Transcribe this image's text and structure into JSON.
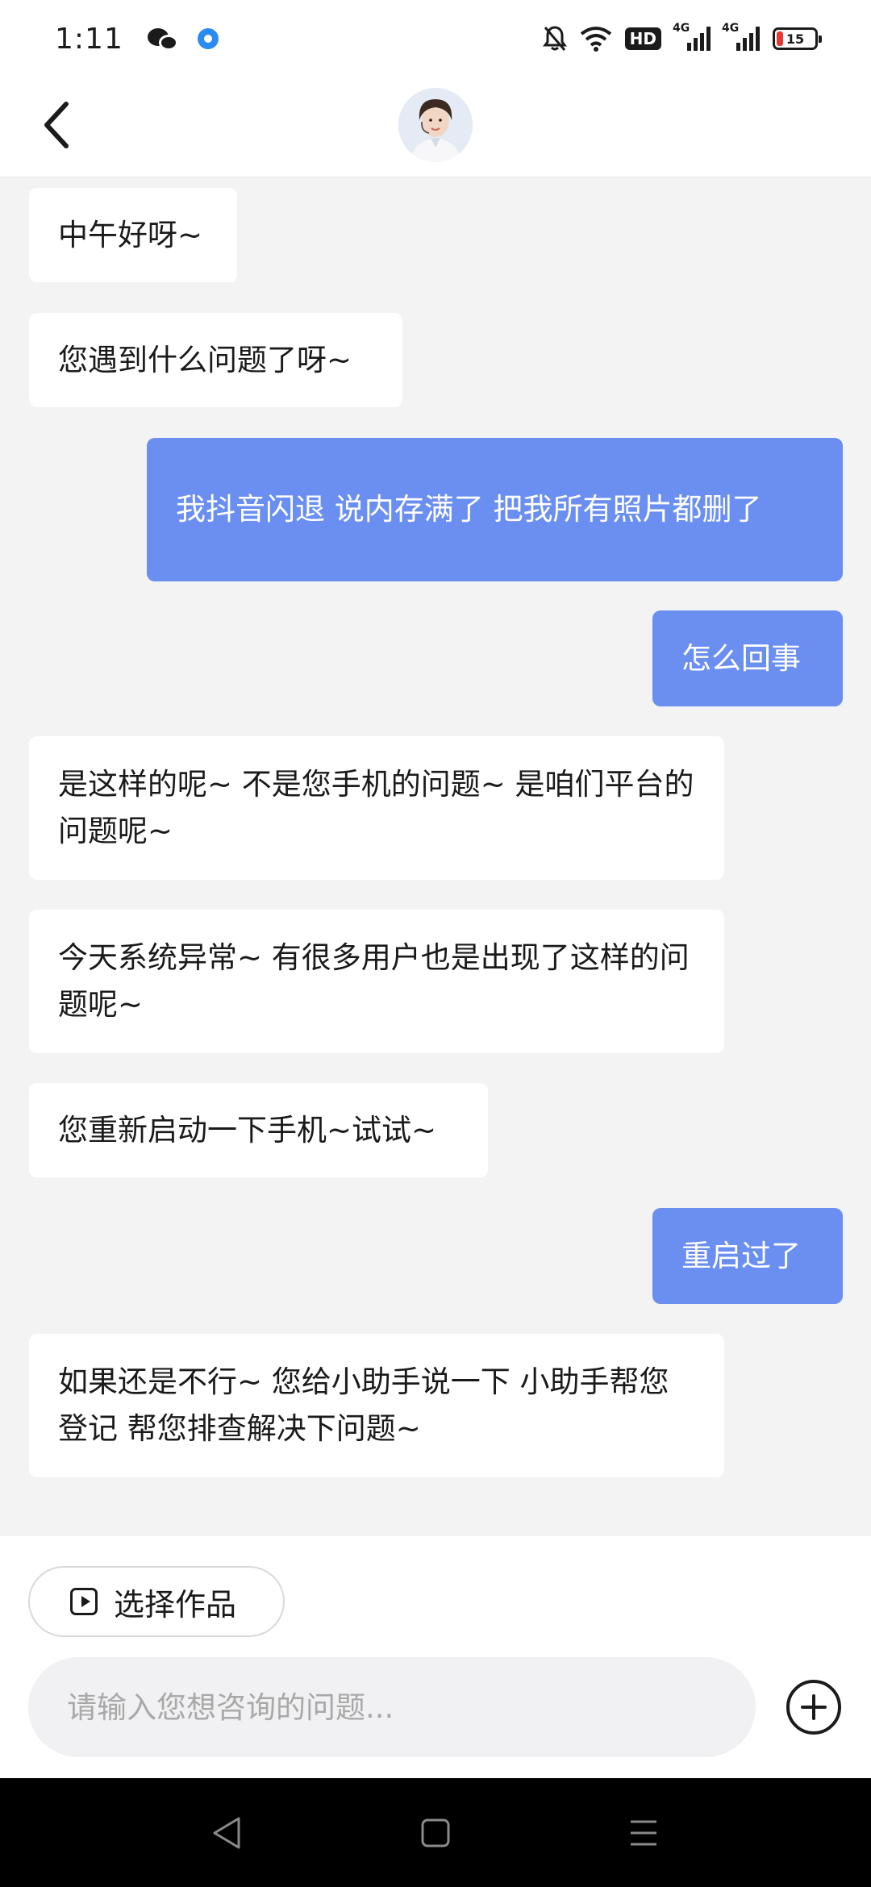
{
  "status_bar": {
    "time": "1:11",
    "hd_label": "HD",
    "signal_labels": [
      "4G",
      "4G"
    ],
    "battery_level": "15",
    "battery_color": "#e53935"
  },
  "header": {
    "back_icon": "chevron-left-icon",
    "avatar_alt": "customer-service-avatar"
  },
  "messages": [
    {
      "side": "left",
      "text": "中午好呀~"
    },
    {
      "side": "left",
      "text": "您遇到什么问题了呀~"
    },
    {
      "side": "right",
      "text": "我抖音闪退 说内存满了 把我所有照片都删了"
    },
    {
      "side": "right",
      "text": "怎么回事"
    },
    {
      "side": "left",
      "text": "是这样的呢~ 不是您手机的问题~ 是咱们平台的问题呢~"
    },
    {
      "side": "left",
      "text": "今天系统异常~ 有很多用户也是出现了这样的问题呢~"
    },
    {
      "side": "left",
      "text": "您重新启动一下手机~试试~"
    },
    {
      "side": "right",
      "text": "重启过了"
    },
    {
      "side": "left",
      "text": "如果还是不行~ 您给小助手说一下 小助手帮您登记 帮您排查解决下问题~"
    }
  ],
  "composer": {
    "select_works_label": "选择作品",
    "input_placeholder": "请输入您想咨询的问题...",
    "input_value": ""
  },
  "colors": {
    "accent": "#6a8ff0",
    "background": "#f3f3f4",
    "bubble_left": "#ffffff"
  }
}
